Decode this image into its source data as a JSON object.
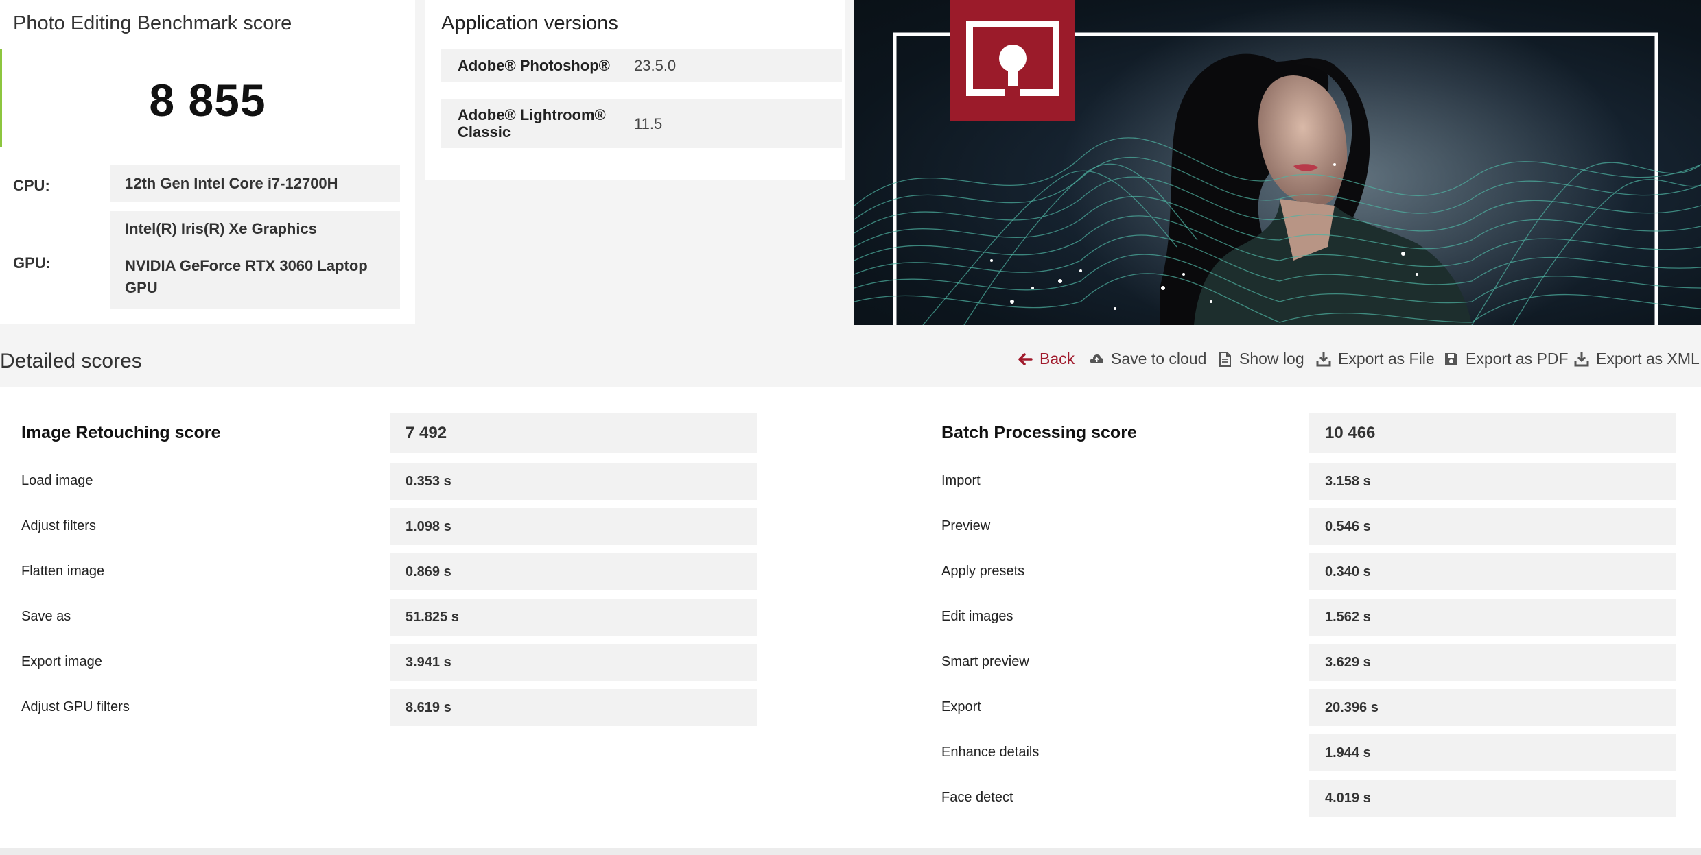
{
  "score_panel": {
    "title": "Photo Editing Benchmark score",
    "score": "8 855",
    "cpu_label": "CPU:",
    "cpu_value": "12th Gen Intel Core i7-12700H",
    "gpu_label": "GPU:",
    "gpu_values": [
      "Intel(R) Iris(R) Xe Graphics",
      "NVIDIA GeForce RTX 3060 Laptop",
      "GPU"
    ]
  },
  "app_versions": {
    "title": "Application versions",
    "apps": [
      {
        "name_lines": [
          "Adobe® Photoshop®"
        ],
        "version": "23.5.0"
      },
      {
        "name_lines": [
          "Adobe® Lightroom®",
          "Classic"
        ],
        "version": "11.5"
      }
    ]
  },
  "hero": {
    "logo_color": "#9b1b2a",
    "wave_color": "#4fb3a3",
    "frame_color": "#ffffff"
  },
  "toolbar": {
    "section_title": "Detailed scores",
    "back": "Back",
    "save_cloud": "Save to cloud",
    "show_log": "Show log",
    "export_file": "Export as File",
    "export_pdf": "Export as PDF",
    "export_xml": "Export as XML",
    "accent_color": "#a0192b"
  },
  "image_retouching": {
    "title": "Image Retouching score",
    "score": "7 492",
    "rows": [
      {
        "label": "Load image",
        "value": "0.353 s"
      },
      {
        "label": "Adjust filters",
        "value": "1.098 s"
      },
      {
        "label": "Flatten image",
        "value": "0.869 s"
      },
      {
        "label": "Save as",
        "value": "51.825 s"
      },
      {
        "label": "Export image",
        "value": "3.941 s"
      },
      {
        "label": "Adjust GPU filters",
        "value": "8.619 s"
      }
    ]
  },
  "batch_processing": {
    "title": "Batch Processing score",
    "score": "10 466",
    "rows": [
      {
        "label": "Import",
        "value": "3.158 s"
      },
      {
        "label": "Preview",
        "value": "0.546 s"
      },
      {
        "label": "Apply presets",
        "value": "0.340 s"
      },
      {
        "label": "Edit images",
        "value": "1.562 s"
      },
      {
        "label": "Smart preview",
        "value": "3.629 s"
      },
      {
        "label": "Export",
        "value": "20.396 s"
      },
      {
        "label": "Enhance details",
        "value": "1.944 s"
      },
      {
        "label": "Face detect",
        "value": "4.019 s"
      }
    ]
  }
}
